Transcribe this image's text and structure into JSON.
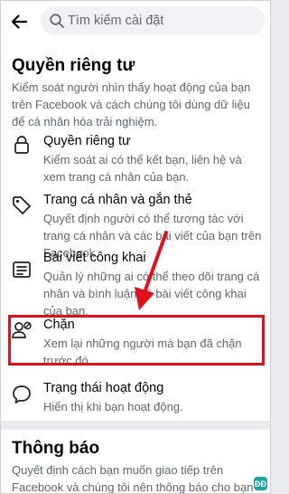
{
  "search": {
    "placeholder": "Tìm kiếm cài đặt"
  },
  "privacy_section": {
    "title": "Quyền riêng tư",
    "description": "Kiểm soát người nhìn thấy hoạt động của bạn trên Facebook và cách chúng tôi dùng dữ liệu để cá nhân hóa trải nghiệm.",
    "items": [
      {
        "icon": "lock-icon",
        "title": "Quyền riêng tư",
        "description": "Kiểm soát ai có thể kết bạn, liên hệ và xem trang cá nhân của bạn."
      },
      {
        "icon": "tag-icon",
        "title": "Trang cá nhân và gắn thẻ",
        "description": "Quyết định người có thể tương tác với trang cá nhân và các bài viết của bạn trên Facebook."
      },
      {
        "icon": "public-posts-icon",
        "title": "Bài viết công khai",
        "description": "Quản lý những ai có thể theo dõi trang cá nhân và bình luận về bài viết công khai của bạn."
      },
      {
        "icon": "blocked-user-icon",
        "title": "Chặn",
        "description": "Xem lại những người mà bạn đã chặn trước đó."
      },
      {
        "icon": "chat-bubble-icon",
        "title": "Trạng thái hoạt động",
        "description": "Hiển thị khi bạn hoạt động."
      }
    ]
  },
  "notifications_section": {
    "title": "Thông báo",
    "description": "Quyết định cách bạn muốn giao tiếp trên Facebook và chúng tôi nên thông báo cho bạn"
  },
  "annotation": {
    "highlight_color": "#e0111b",
    "watermark": "ĐĐ"
  }
}
